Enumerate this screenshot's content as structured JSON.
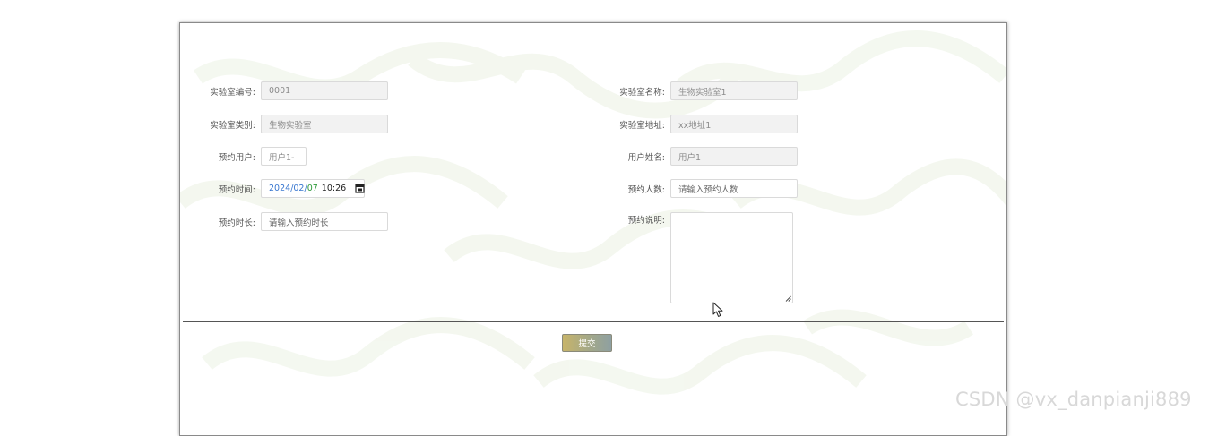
{
  "form": {
    "lab_number": {
      "label": "实验室编号:",
      "value": "0001"
    },
    "lab_name": {
      "label": "实验室名称:",
      "value": "生物实验室1"
    },
    "lab_category": {
      "label": "实验室类别:",
      "value": "生物实验室"
    },
    "lab_address": {
      "label": "实验室地址:",
      "value": "xx地址1"
    },
    "booking_user": {
      "label": "预约用户:",
      "value": "用户1-"
    },
    "user_name": {
      "label": "用户姓名:",
      "value": "用户1"
    },
    "booking_time": {
      "label": "预约时间:",
      "year": "2024",
      "month": "02",
      "day": "07",
      "time": "10:26",
      "separator": "/"
    },
    "booking_count": {
      "label": "预约人数:",
      "placeholder": "请输入预约人数"
    },
    "booking_duration": {
      "label": "预约时长:",
      "placeholder": "请输入预约时长"
    },
    "booking_note": {
      "label": "预约说明:",
      "value": ""
    }
  },
  "submit_label": "提交",
  "watermark": "CSDN @vx_danpianji889",
  "colors": {
    "submit_gradient_start": "#c7b46a",
    "submit_gradient_end": "#8ea0a2",
    "date_year": "#3a78d0",
    "date_day": "#2e9a3a"
  }
}
